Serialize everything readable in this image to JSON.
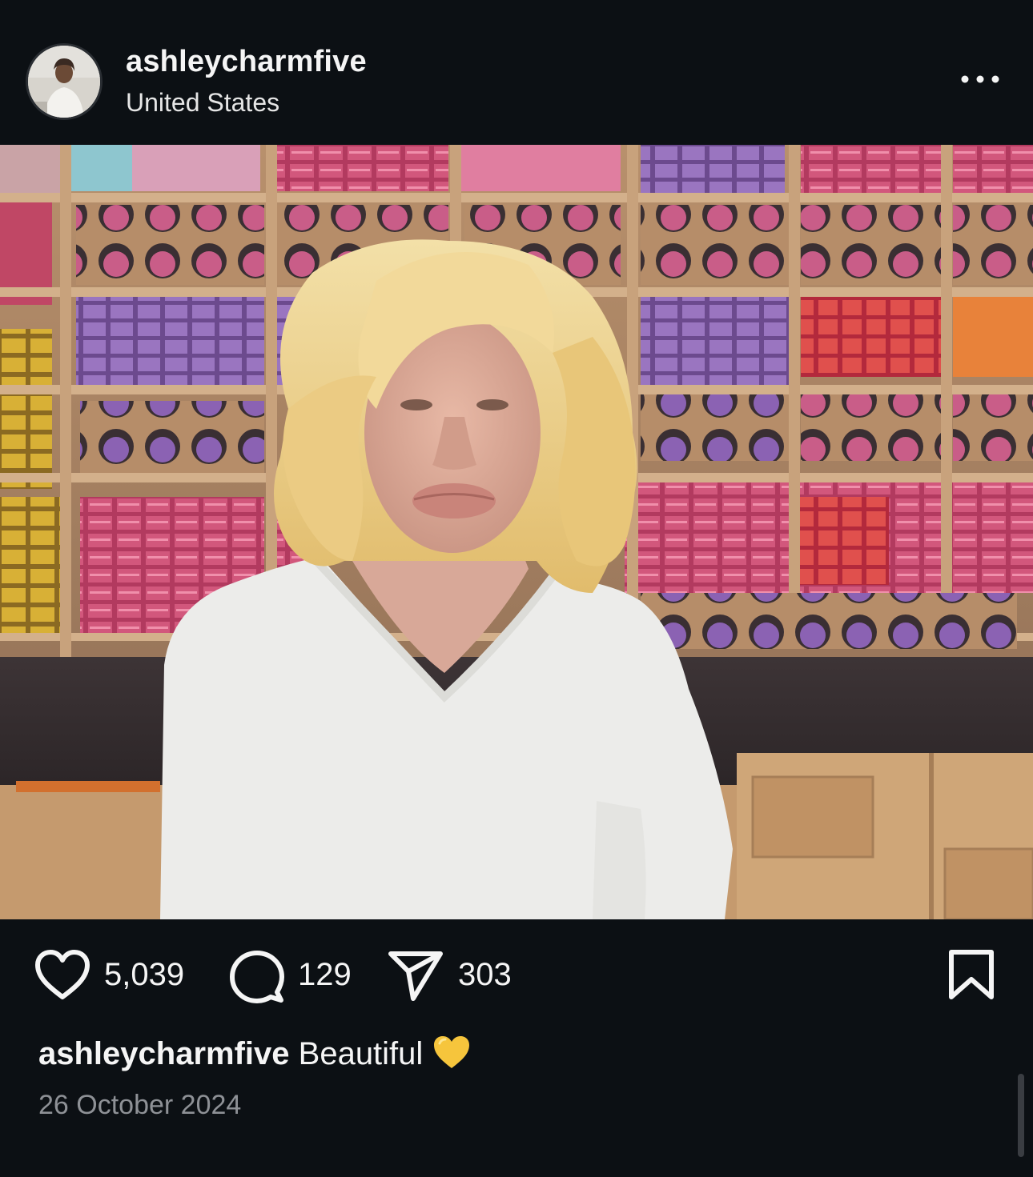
{
  "post": {
    "username": "ashleycharmfive",
    "location": "United States",
    "avatar": "profile-photo",
    "more_icon": "more-horizontal-icon"
  },
  "photo": {
    "subject": "person in white top standing in front of store shelves",
    "colors": {
      "shelf_wood": "#c89f76",
      "product_pink": "#c2456e",
      "product_purple": "#8e5ba8",
      "hair": "#f0d79a",
      "shirt": "#eeeeea"
    }
  },
  "actions": {
    "likes": "5,039",
    "comments": "129",
    "shares": "303",
    "like_icon": "heart-icon",
    "comment_icon": "comment-icon",
    "share_icon": "paper-plane-icon",
    "save_icon": "bookmark-icon"
  },
  "caption": {
    "username": "ashleycharmfive",
    "text": "Beautiful",
    "emoji": "💛"
  },
  "date": "26 October 2024"
}
